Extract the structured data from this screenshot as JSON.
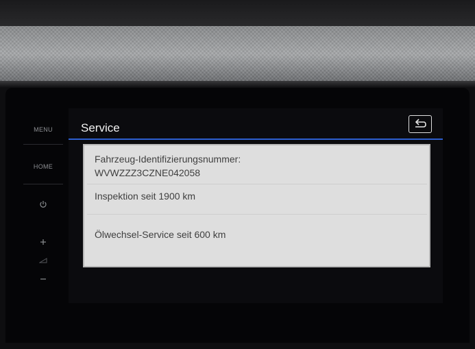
{
  "side_panel": {
    "menu_label": "MENU",
    "home_label": "HOME",
    "power_icon": "power-icon",
    "volume_up_icon": "plus-icon",
    "volume_icon": "volume-icon",
    "volume_down_icon": "minus-icon"
  },
  "header": {
    "title": "Service",
    "back_icon": "back-icon"
  },
  "service_info": {
    "vin_label": "Fahrzeug-Identifizierungsnummer:",
    "vin_value": "WVWZZZ3CZNE042058",
    "inspection": "Inspektion seit 1900 km",
    "oil_change": "Ölwechsel-Service seit 600 km"
  },
  "colors": {
    "accent_line": "#2d5fd0",
    "panel_background": "#dedede",
    "text": "#3f3f3f"
  }
}
